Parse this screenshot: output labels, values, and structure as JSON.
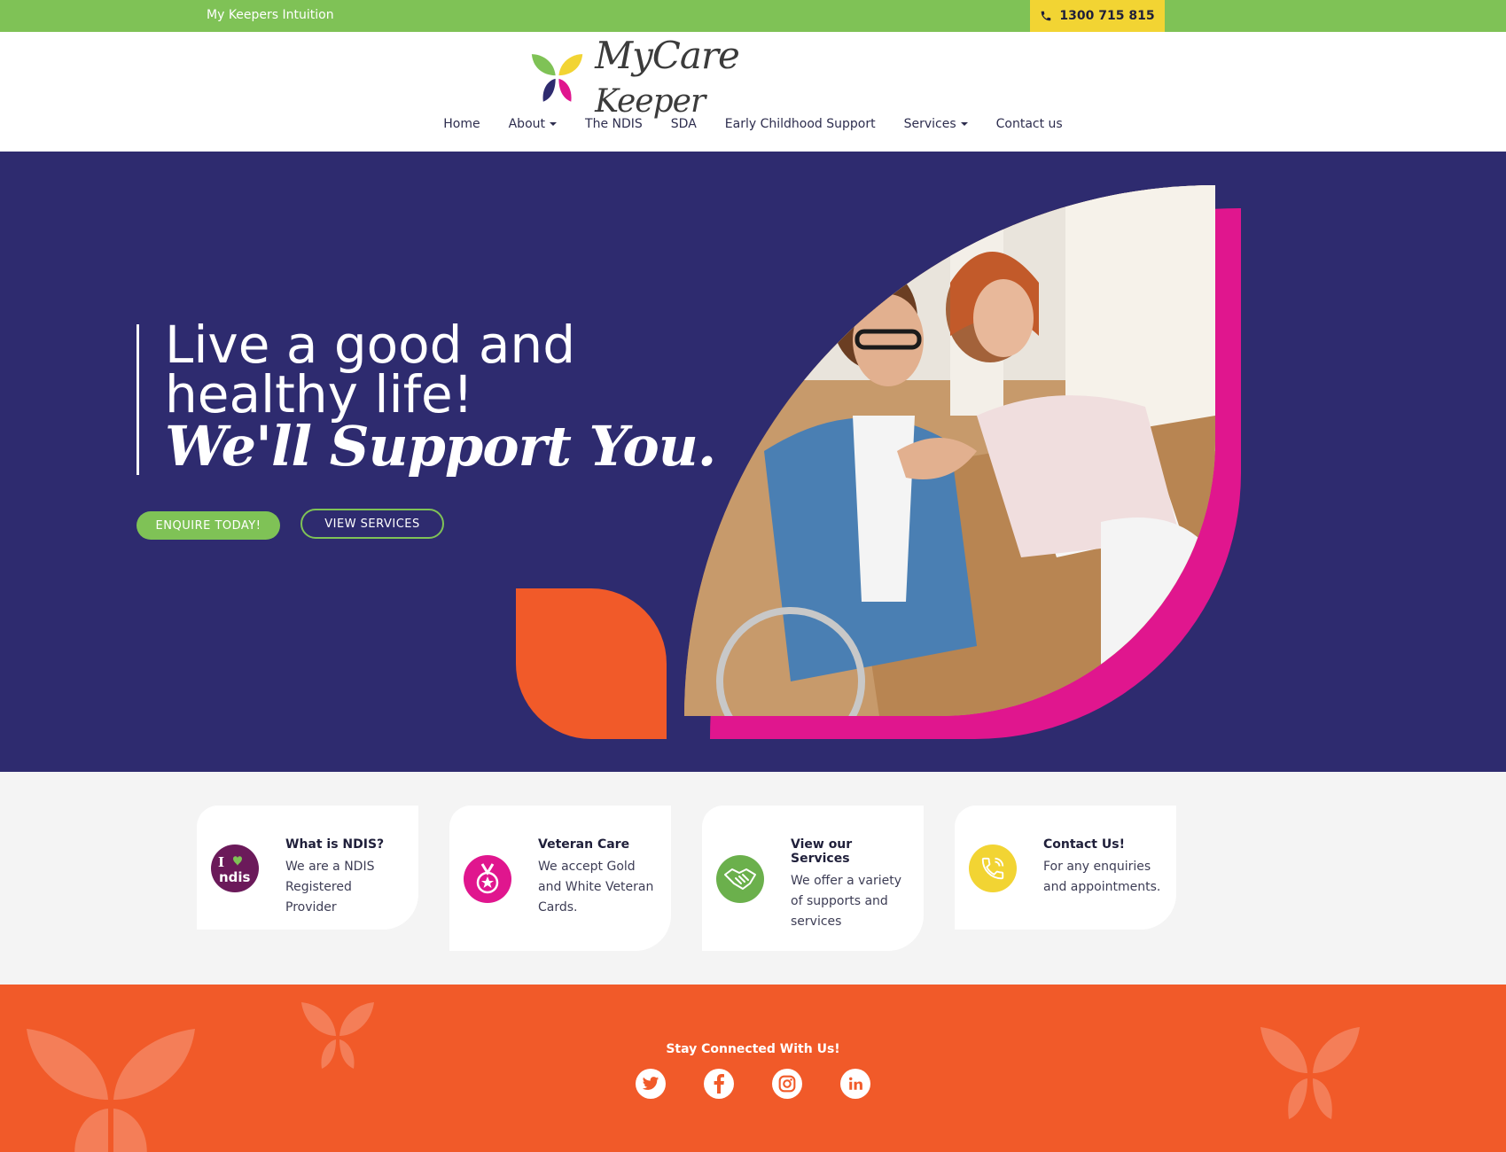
{
  "topbar": {
    "tagline": "My Keepers Intuition",
    "phone": "1300 715 815"
  },
  "brand": {
    "name_my": "My",
    "name_care": "Care",
    "name_keeper": "Keeper"
  },
  "nav": {
    "items": [
      {
        "label": "Home",
        "dropdown": false
      },
      {
        "label": "About",
        "dropdown": true
      },
      {
        "label": "The NDIS",
        "dropdown": false
      },
      {
        "label": "SDA",
        "dropdown": false
      },
      {
        "label": "Early Childhood Support",
        "dropdown": false
      },
      {
        "label": "Services",
        "dropdown": true
      },
      {
        "label": "Contact us",
        "dropdown": false
      }
    ]
  },
  "hero": {
    "headline": "Live a good and healthy life!",
    "script": "We'll Support You.",
    "enquire_label": "ENQUIRE TODAY!",
    "services_label": "VIEW SERVICES"
  },
  "features": [
    {
      "title": "What is NDIS?",
      "desc": "We are a NDIS Registered Provider",
      "icon": "ndis-icon",
      "color": "#6b1a5a"
    },
    {
      "title": "Veteran Care",
      "desc": "We accept Gold and White Veteran Cards.",
      "icon": "medal-icon",
      "color": "#e0168e"
    },
    {
      "title": "View our Services",
      "desc": "We offer a variety of supports and services",
      "icon": "handshake-icon",
      "color": "#6bb04c"
    },
    {
      "title": "Contact Us!",
      "desc": "For any enquiries and appointments.",
      "icon": "phone-icon",
      "color": "#f2d433"
    }
  ],
  "footer": {
    "stay": "Stay Connected With Us!",
    "socials": [
      "twitter-icon",
      "facebook-icon",
      "instagram-icon",
      "linkedin-icon"
    ]
  },
  "colors": {
    "green": "#7fc256",
    "yellow": "#f2d433",
    "navy": "#2e2b6f",
    "pink": "#e0168e",
    "orange": "#f15a29"
  }
}
